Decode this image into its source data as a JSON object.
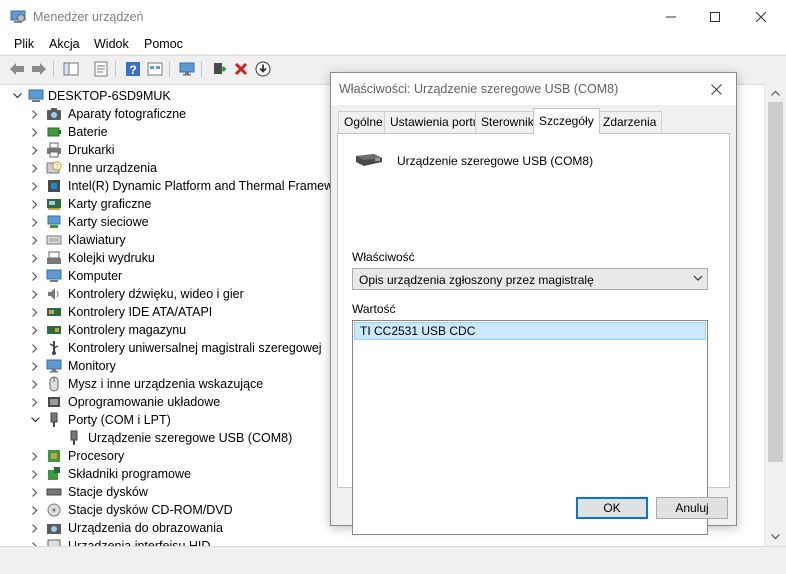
{
  "window": {
    "title": "Menedżer urządzeń"
  },
  "menu": [
    "Plik",
    "Akcja",
    "Widok",
    "Pomoc"
  ],
  "toolbar": {
    "icons": [
      "back-arrow-icon",
      "forward-arrow-icon",
      "show-hide-tree-icon",
      "properties-icon",
      "help-icon",
      "view-icon",
      "monitor-icon",
      "add-driver-icon",
      "uninstall-icon",
      "download-icon"
    ]
  },
  "tree": {
    "root": "DESKTOP-6SD9MUK",
    "items": [
      {
        "label": "Aparaty fotograficzne",
        "icon": "camera-icon",
        "expanded": false
      },
      {
        "label": "Baterie",
        "icon": "battery-icon",
        "expanded": false
      },
      {
        "label": "Drukarki",
        "icon": "printer-icon",
        "expanded": false
      },
      {
        "label": "Inne urządzenia",
        "icon": "unknown-device-icon",
        "expanded": false
      },
      {
        "label": "Intel(R) Dynamic Platform and Thermal Framework",
        "icon": "chip-icon",
        "expanded": false
      },
      {
        "label": "Karty graficzne",
        "icon": "display-adapter-icon",
        "expanded": false
      },
      {
        "label": "Karty sieciowe",
        "icon": "network-adapter-icon",
        "expanded": false
      },
      {
        "label": "Klawiatury",
        "icon": "keyboard-icon",
        "expanded": false
      },
      {
        "label": "Kolejki wydruku",
        "icon": "print-queue-icon",
        "expanded": false
      },
      {
        "label": "Komputer",
        "icon": "computer-icon",
        "expanded": false
      },
      {
        "label": "Kontrolery dźwięku, wideo i gier",
        "icon": "speaker-icon",
        "expanded": false
      },
      {
        "label": "Kontrolery IDE ATA/ATAPI",
        "icon": "ide-controller-icon",
        "expanded": false
      },
      {
        "label": "Kontrolery magazynu",
        "icon": "storage-controller-icon",
        "expanded": false
      },
      {
        "label": "Kontrolery uniwersalnej magistrali szeregowej",
        "icon": "usb-icon",
        "expanded": false
      },
      {
        "label": "Monitory",
        "icon": "monitor-icon",
        "expanded": false
      },
      {
        "label": "Mysz i inne urządzenia wskazujące",
        "icon": "mouse-icon",
        "expanded": false
      },
      {
        "label": "Oprogramowanie układowe",
        "icon": "firmware-icon",
        "expanded": false
      },
      {
        "label": "Porty (COM i LPT)",
        "icon": "port-icon",
        "expanded": true
      },
      {
        "label": "Urządzenie szeregowe USB (COM8)",
        "icon": "port-icon",
        "child": true
      },
      {
        "label": "Procesory",
        "icon": "processor-icon",
        "expanded": false
      },
      {
        "label": "Składniki programowe",
        "icon": "software-component-icon",
        "expanded": false
      },
      {
        "label": "Stacje dysków",
        "icon": "disk-drive-icon",
        "expanded": false
      },
      {
        "label": "Stacje dysków CD-ROM/DVD",
        "icon": "cd-rom-icon",
        "expanded": false
      },
      {
        "label": "Urządzenia do obrazowania",
        "icon": "imaging-device-icon",
        "expanded": false
      },
      {
        "label": "Urządzenia interfejsu HID",
        "icon": "hid-icon",
        "expanded": false
      }
    ]
  },
  "dialog": {
    "title": "Właściwości: Urządzenie szeregowe USB (COM8)",
    "tabs": [
      "Ogólne",
      "Ustawienia portu",
      "Sterownik",
      "Szczegóły",
      "Zdarzenia"
    ],
    "active_tab": "Szczegóły",
    "device_name": "Urządzenie szeregowe USB (COM8)",
    "property_label": "Właściwość",
    "property_value": "Opis urządzenia zgłoszony przez magistralę",
    "value_label": "Wartość",
    "values": [
      "TI CC2531 USB CDC"
    ],
    "ok": "OK",
    "cancel": "Anuluj"
  },
  "colors": {
    "selection": "#cce8ff",
    "accent": "#0078d7"
  }
}
